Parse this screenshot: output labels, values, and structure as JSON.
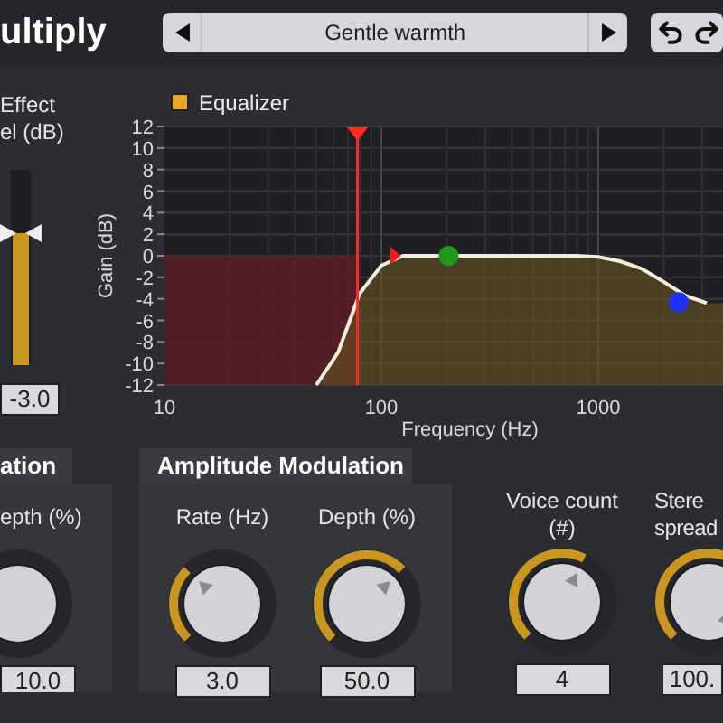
{
  "header": {
    "title": "ultiply",
    "preset": "Gentle warmth"
  },
  "effect_level": {
    "label_lines": [
      "Effect",
      "el (dB)"
    ],
    "level": 0.68,
    "value": "-3.0"
  },
  "equalizer": {
    "legend": {
      "label": "Equalizer",
      "color": "#e8a820"
    },
    "chart_data": {
      "type": "line",
      "xlabel": "Frequency (Hz)",
      "ylabel": "Gain (dB)",
      "categories": [
        "10",
        null,
        null,
        null,
        null,
        null,
        null,
        null,
        null,
        null,
        "100",
        null,
        null,
        null,
        null,
        null,
        null,
        null,
        null,
        null,
        "1000",
        null,
        null,
        null,
        null,
        null
      ],
      "series": [
        {
          "color": "#f2eedc",
          "values": [
            null,
            null,
            null,
            null,
            null,
            null,
            null,
            -12,
            -9,
            -3.5,
            -0.9,
            0,
            0,
            0,
            0,
            0,
            0,
            0,
            0,
            0,
            -0.1,
            -0.5,
            -1.2,
            -2.4,
            -3.7,
            -4.4
          ]
        }
      ],
      "ylim": [
        -12,
        12
      ],
      "grid": true,
      "yticks": [
        12,
        10,
        8,
        6,
        4,
        2,
        0,
        -2,
        -4,
        -6,
        -8,
        -10,
        -12
      ]
    },
    "cursor": {
      "color": "#ff2a2a"
    },
    "band_handles": [
      {
        "kind": "triangle",
        "color": "#e82020"
      },
      {
        "kind": "circle",
        "color": "#1e9a1e"
      },
      {
        "kind": "circle",
        "color": "#2030ff"
      }
    ]
  },
  "sections": [
    {
      "title": "ation",
      "controls": [
        {
          "label_lines": [
            "epth (%)"
          ],
          "value": "10.0"
        }
      ]
    },
    {
      "title": "Amplitude Modulation",
      "controls": [
        {
          "label_lines": [
            "Rate (Hz)"
          ],
          "value": "3.0"
        },
        {
          "label_lines": [
            "Depth (%)"
          ],
          "value": "50.0"
        }
      ]
    }
  ],
  "voice_count": {
    "label_lines": [
      "Voice count",
      "(#)"
    ],
    "value": "4"
  },
  "stereo_spread": {
    "label_lines": [
      "Stere",
      "spread"
    ],
    "value": "100."
  }
}
